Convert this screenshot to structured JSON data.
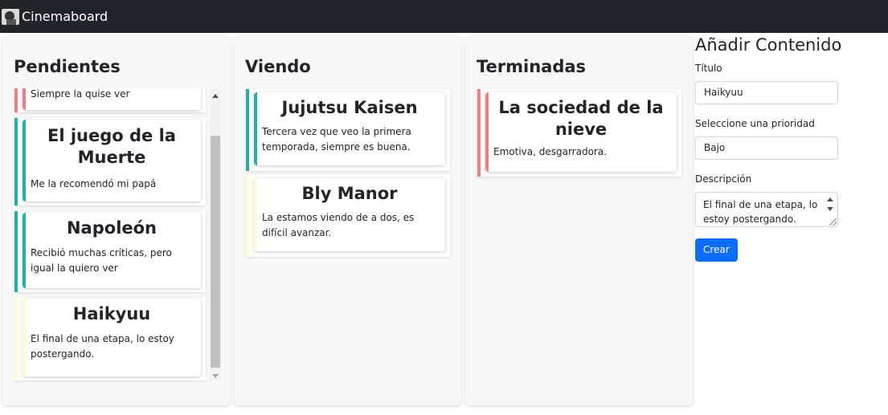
{
  "navbar": {
    "brand": "Cinemaboard",
    "logo_icon": "film-avatar-icon"
  },
  "colors": {
    "accent_teal": "#20b2aa",
    "accent_red": "#f08080",
    "accent_yellow": "#fffdd0",
    "primary": "#0d6efd"
  },
  "columns": [
    {
      "title": "Pendientes",
      "cards": [
        {
          "title": "",
          "text": "Siempre la quise ver",
          "color": "#f08080"
        },
        {
          "title": "El juego de la Muerte",
          "text": "Me la recomendó mi papá",
          "color": "#20b2aa"
        },
        {
          "title": "Napoleón",
          "text": "Recibió muchas críticas, pero igual la quiero ver",
          "color": "#20b2aa"
        },
        {
          "title": "Haikyuu",
          "text": "El final de una etapa, lo estoy postergando.",
          "color": "#fffdd0"
        }
      ]
    },
    {
      "title": "Viendo",
      "cards": [
        {
          "title": "Jujutsu Kaisen",
          "text": "Tercera vez que veo la primera temporada, siempre es buena.",
          "color": "#20b2aa"
        },
        {
          "title": "Bly Manor",
          "text": "La estamos viendo de a dos, es difícil avanzar.",
          "color": "#fffdd0"
        }
      ]
    },
    {
      "title": "Terminadas",
      "cards": [
        {
          "title": "La sociedad de la nieve",
          "text": "Emotiva, desgarradora.",
          "color": "#f08080"
        }
      ]
    }
  ],
  "form": {
    "heading": "Añadir Contenido",
    "title_label": "Título",
    "title_value": "Haikyuu",
    "priority_label": "Seleccione una prioridad",
    "priority_value": "Bajo",
    "description_label": "Descripción",
    "description_value": "El final de una etapa, lo estoy postergando.",
    "submit_label": "Crear"
  }
}
